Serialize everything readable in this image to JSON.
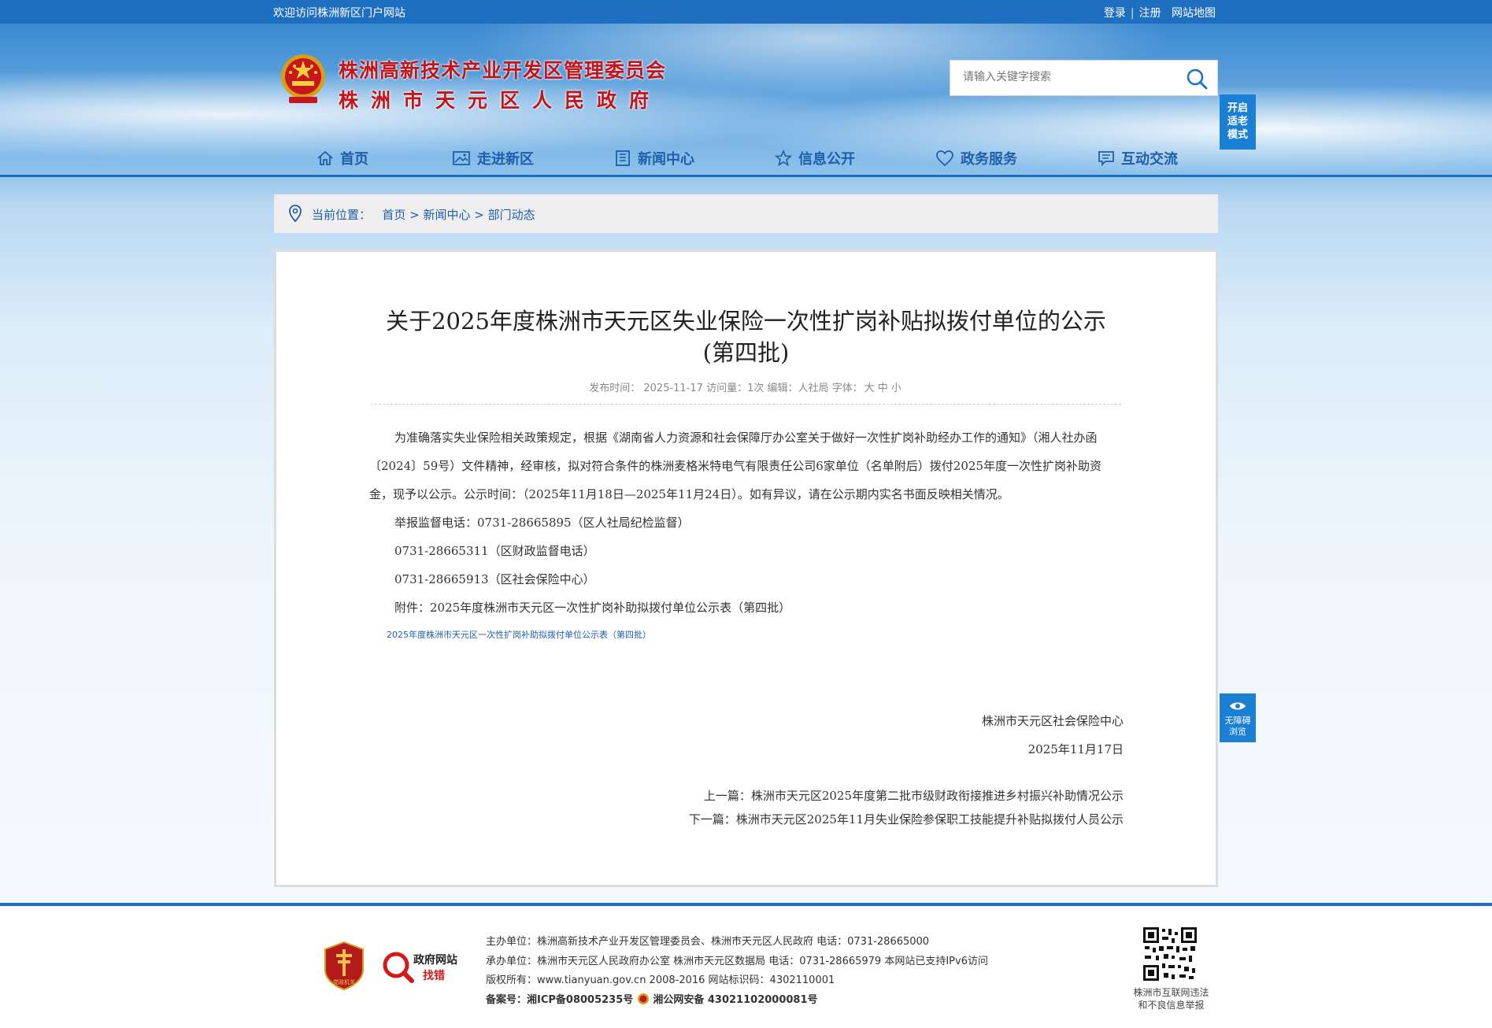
{
  "topbar": {
    "welcome": "欢迎访问株洲新区门户网站",
    "login": "登录",
    "register": "注册",
    "sitemap": "网站地图",
    "separator": "|"
  },
  "header": {
    "org_line1": "株洲高新技术产业开发区管理委员会",
    "org_line2": "株洲市天元区人民政府",
    "search_placeholder": "请输入关键字搜索",
    "elder_mode": [
      "开启",
      "适老",
      "模式"
    ]
  },
  "nav": {
    "items": [
      {
        "label": "首页",
        "icon": "home-icon"
      },
      {
        "label": "走进新区",
        "icon": "picture-icon"
      },
      {
        "label": "新闻中心",
        "icon": "newspaper-icon"
      },
      {
        "label": "信息公开",
        "icon": "star-icon"
      },
      {
        "label": "政务服务",
        "icon": "heart-icon"
      },
      {
        "label": "互动交流",
        "icon": "chat-icon"
      }
    ]
  },
  "breadcrumb": {
    "label": "当前位置：",
    "items": [
      "首页",
      "新闻中心",
      "部门动态"
    ],
    "sep": ">"
  },
  "article": {
    "title_line1": "关于2025年度株洲市天元区失业保险一次性扩岗补贴拟拨付单位的公示",
    "title_line2": "(第四批)",
    "meta": {
      "publish_label": "发布时间：",
      "publish_date": "2025-11-17",
      "visits_label": "访问量：",
      "visits": "1次",
      "editor_label": "编辑：",
      "editor": "人社局",
      "font_label": "字体：",
      "font_large": "大",
      "font_medium": "中",
      "font_small": "小"
    },
    "para1": "为准确落实失业保险相关政策规定，根据《湖南省人力资源和社会保障厅办公室关于做好一次性扩岗补助经办工作的通知》（湘人社办函〔2024〕59号）文件精神，经审核，拟对符合条件的株洲麦格米特电气有限责任公司6家单位（名单附后）拨付2025年度一次性扩岗补助资金，现予以公示。公示时间：（2025年11月18日—2025年11月24日）。如有异议，请在公示期内实名书面反映相关情况。",
    "phone1": "举报监督电话：0731-28665895（区人社局纪检监督）",
    "phone2": "0731-28665311（区财政监督电话）",
    "phone3": "0731-28665913（区社会保险中心）",
    "attachment": "附件：2025年度株洲市天元区一次性扩岗补助拟拨付单位公示表（第四批）",
    "attachment_link": "2025年度株洲市天元区一次性扩岗补助拟拨付单位公示表（第四批）",
    "sign_org": "株洲市天元区社会保险中心",
    "sign_date": "2025年11月17日",
    "prev": "上一篇：株洲市天元区2025年度第二批市级财政衔接推进乡村振兴补助情况公示",
    "next": "下一篇：株洲市天元区2025年11月失业保险参保职工技能提升补贴拟拨付人员公示"
  },
  "accessibility": [
    "无障碍",
    "浏览"
  ],
  "footer": {
    "badge1_text": "党政机关",
    "badge2_line1": "政府网站",
    "badge2_line2": "找错",
    "line1": "主办单位：株洲高新技术产业开发区管理委员会、株洲市天元区人民政府 电话：0731-28665000",
    "line2": "承办单位：株洲市天元区人民政府办公室 株洲市天元区数据局 电话：0731-28665979 本网站已支持IPv6访问",
    "line3": "版权所有：www.tianyuan.gov.cn 2008-2016 网站标识码：4302110001",
    "icp": "备案号：湘ICP备08005235号",
    "police": "湘公网安备 43021102000081号",
    "qr_line1": "株洲市互联网违法",
    "qr_line2": "和不良信息举报"
  },
  "colors": {
    "primary_blue": "#1f6fc1",
    "nav_text": "#1f5ea8",
    "org_red": "#c0151a"
  }
}
